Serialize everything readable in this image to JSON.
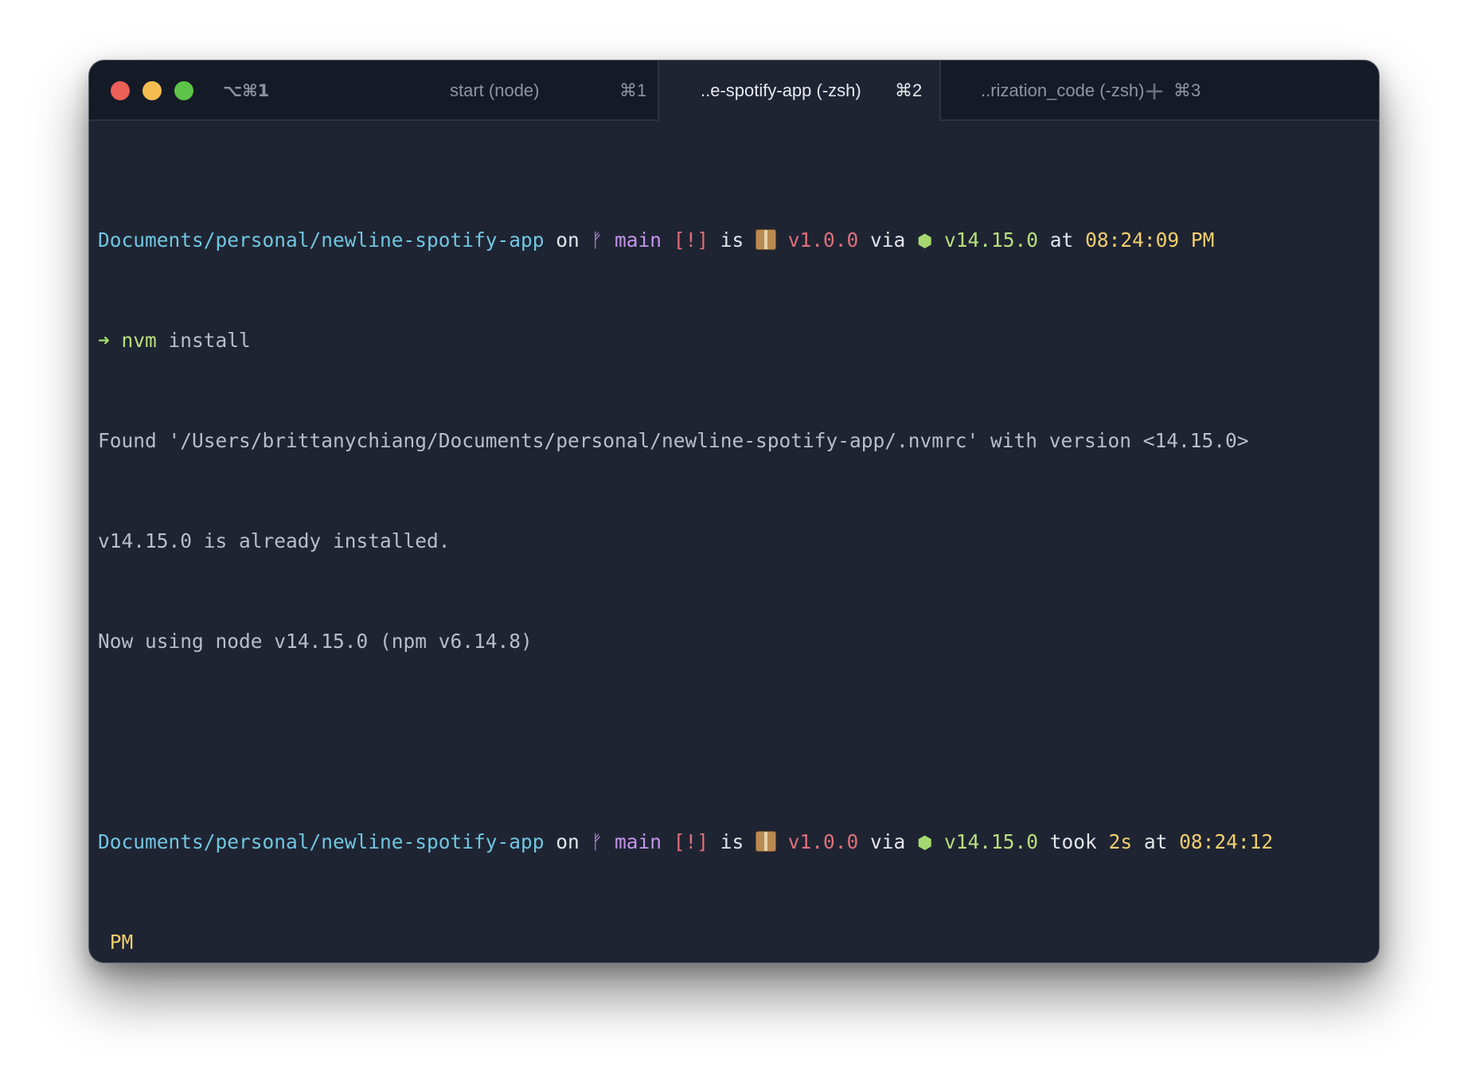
{
  "window": {
    "shortcut": "⌥⌘1",
    "tabs": [
      {
        "label": "start (node)",
        "key": "⌘1",
        "active": false
      },
      {
        "label": "..e-spotify-app (-zsh)",
        "key": "⌘2",
        "active": true
      },
      {
        "label": "..rization_code (-zsh)",
        "key": "⌘3",
        "active": false
      }
    ],
    "add_tab_label": "+"
  },
  "terminal": {
    "prompt1": {
      "path": "Documents/personal/newline-spotify-app",
      "on": " on ",
      "branch_icon": "ᚠ",
      "branch": " main",
      "status": " [!]",
      "is": " is ",
      "pkg_version": " v1.0.0",
      "via": " via ",
      "node_icon": "⬢",
      "node_version": " v14.15.0",
      "at": " at ",
      "time": "08:24:09 PM"
    },
    "command": {
      "arrow": "➜",
      "cmd": " nvm",
      "args": " install"
    },
    "output": [
      "Found '/Users/brittanychiang/Documents/personal/newline-spotify-app/.nvmrc' with version <14.15.0>",
      "v14.15.0 is already installed.",
      "Now using node v14.15.0 (npm v6.14.8)"
    ],
    "prompt2": {
      "path": "Documents/personal/newline-spotify-app",
      "on": " on ",
      "branch_icon": "ᚠ",
      "branch": " main",
      "status": " [!]",
      "is": " is ",
      "pkg_version": " v1.0.0",
      "via": " via ",
      "node_icon": "⬢",
      "node_version": " v14.15.0",
      "took": " took ",
      "duration": "2s",
      "at": " at ",
      "time": "08:24:12",
      "time_wrap": " PM"
    },
    "cursor_arrow": "➜"
  },
  "colors": {
    "background": "#1f2433",
    "titlebar": "#151a27",
    "path": "#70c6e0",
    "branch": "#c395ec",
    "status": "#e0707a",
    "node": "#b8e07c",
    "time": "#f2cf6e"
  }
}
